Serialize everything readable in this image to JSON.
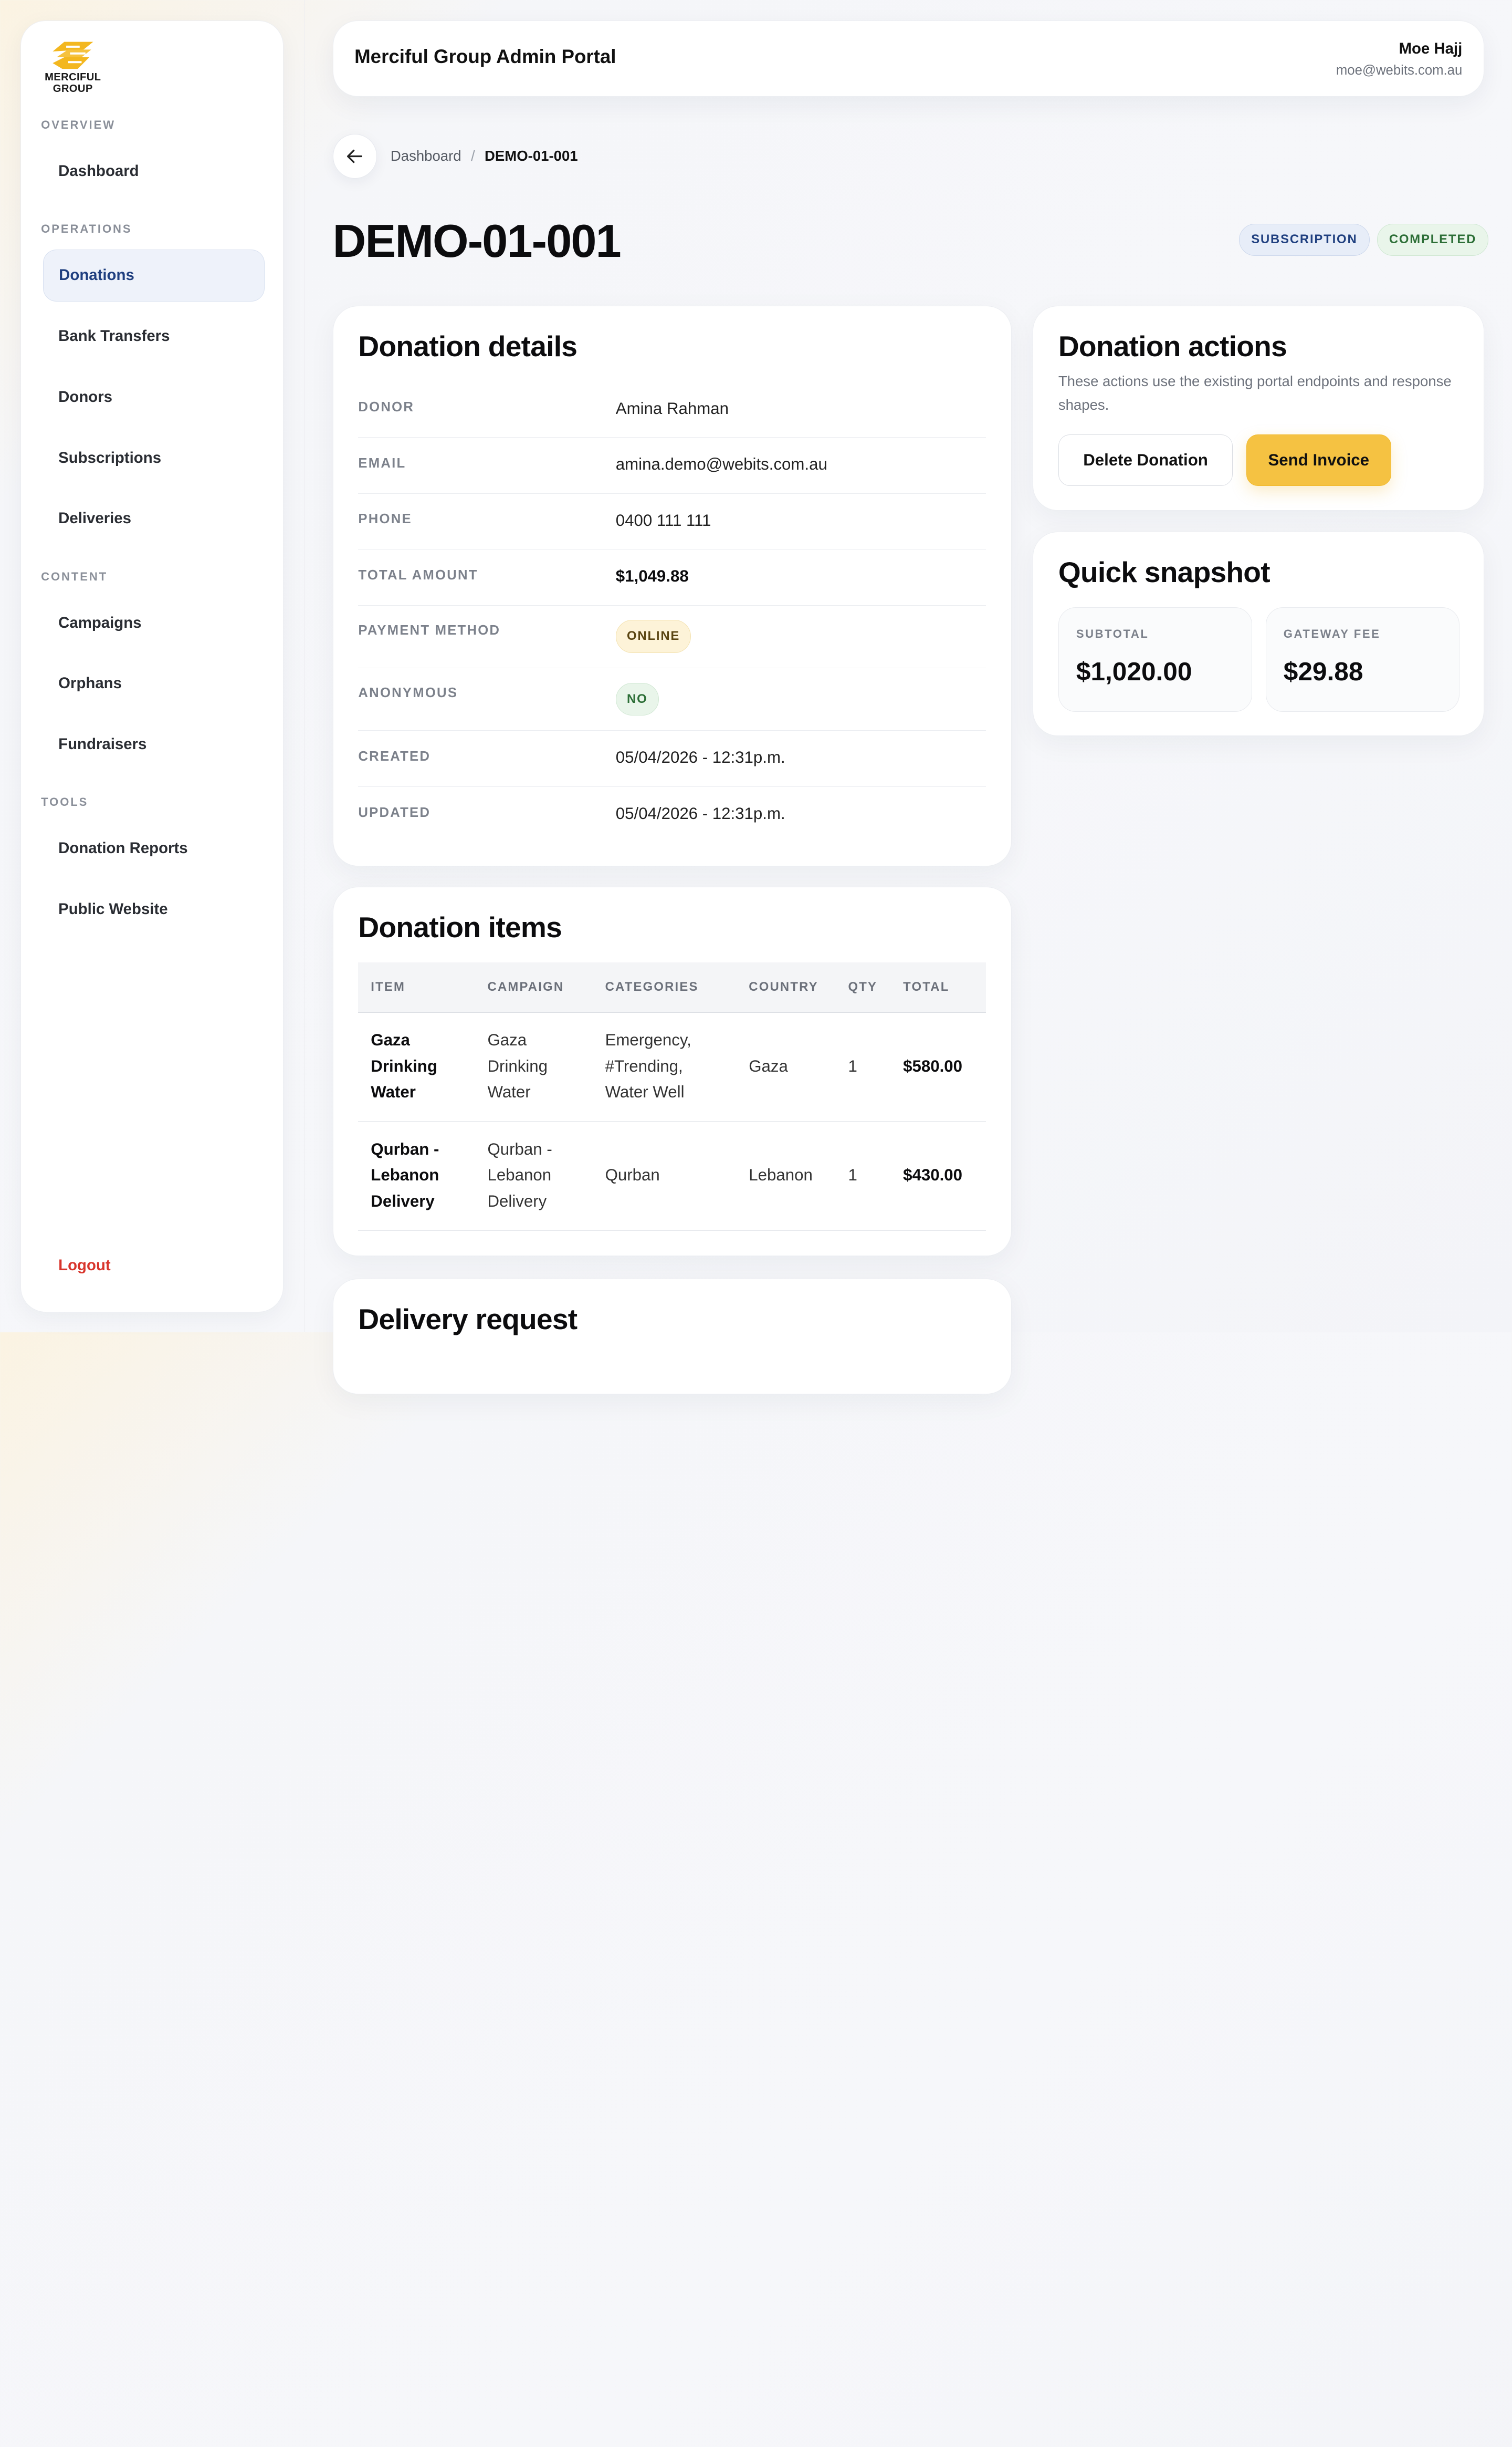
{
  "brand": {
    "logo_line1": "MERCIFUL",
    "logo_line2": "GROUP"
  },
  "sidebar": {
    "sections": {
      "overview": "OVERVIEW",
      "operations": "OPERATIONS",
      "content": "CONTENT",
      "tools": "TOOLS"
    },
    "items": {
      "dashboard": "Dashboard",
      "donations": "Donations",
      "bank_transfers": "Bank Transfers",
      "donors": "Donors",
      "subscriptions": "Subscriptions",
      "deliveries": "Deliveries",
      "campaigns": "Campaigns",
      "orphans": "Orphans",
      "fundraisers": "Fundraisers",
      "donation_reports": "Donation Reports",
      "public_website": "Public Website"
    },
    "logout": "Logout"
  },
  "header": {
    "title": "Merciful Group Admin Portal",
    "user_name": "Moe Hajj",
    "user_email": "moe@webits.com.au"
  },
  "breadcrumb": {
    "parent": "Dashboard",
    "separator": "/",
    "current": "DEMO-01-001"
  },
  "page": {
    "title": "DEMO-01-001",
    "badges": {
      "type": "SUBSCRIPTION",
      "status": "COMPLETED"
    }
  },
  "details": {
    "title": "Donation details",
    "donor_label": "DONOR",
    "donor": "Amina Rahman",
    "email_label": "EMAIL",
    "email": "amina.demo@webits.com.au",
    "phone_label": "PHONE",
    "phone": "0400 111 111",
    "total_label": "TOTAL AMOUNT",
    "total": "$1,049.88",
    "payment_label": "PAYMENT METHOD",
    "payment": "ONLINE",
    "anonymous_label": "ANONYMOUS",
    "anonymous": "NO",
    "created_label": "CREATED",
    "created": "05/04/2026 - 12:31p.m.",
    "updated_label": "UPDATED",
    "updated": "05/04/2026 - 12:31p.m."
  },
  "actions": {
    "title": "Donation actions",
    "description": "These actions use the existing portal endpoints and response shapes.",
    "delete_label": "Delete Donation",
    "invoice_label": "Send Invoice"
  },
  "snapshot": {
    "title": "Quick snapshot",
    "subtotal_label": "SUBTOTAL",
    "subtotal": "$1,020.00",
    "fee_label": "GATEWAY FEE",
    "fee": "$29.88"
  },
  "items": {
    "title": "Donation items",
    "columns": [
      "ITEM",
      "CAMPAIGN",
      "CATEGORIES",
      "COUNTRY",
      "QTY",
      "TOTAL"
    ],
    "rows": [
      {
        "item": [
          "Gaza",
          "Drinking",
          "Water"
        ],
        "campaign": [
          "Gaza",
          "Drinking",
          "Water"
        ],
        "categories": [
          "Emergency,",
          "#Trending,",
          "Water Well"
        ],
        "country": "Gaza",
        "qty": "1",
        "total": "$580.00"
      },
      {
        "item": [
          "Qurban -",
          "Lebanon",
          "Delivery"
        ],
        "campaign": [
          "Qurban -",
          "Lebanon",
          "Delivery"
        ],
        "categories": [
          "Qurban"
        ],
        "country": "Lebanon",
        "qty": "1",
        "total": "$430.00"
      }
    ]
  },
  "delivery": {
    "title": "Delivery request"
  },
  "icons": {
    "back": "arrow-left-icon",
    "logo": "merciful-group-logo"
  },
  "colors": {
    "accent": "#f5c242",
    "primary_nav": "#1f3f7f",
    "logout": "#d8352c",
    "success": "#2c6e36"
  }
}
